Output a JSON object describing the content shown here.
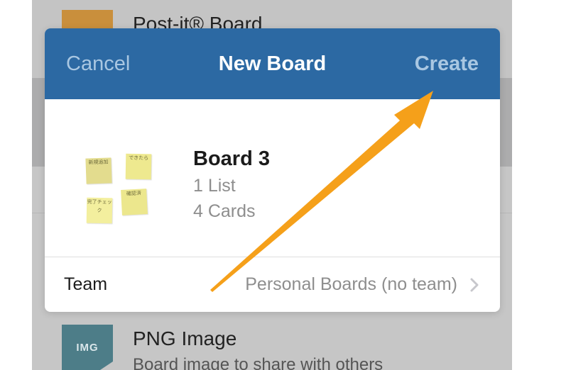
{
  "background": {
    "top_item": {
      "title": "Post-it® Board"
    },
    "bottom_item": {
      "thumb_label": "IMG",
      "title": "PNG Image",
      "subtitle": "Board image to share with others"
    }
  },
  "modal": {
    "nav": {
      "cancel_label": "Cancel",
      "title": "New Board",
      "create_label": "Create"
    },
    "board": {
      "name": "Board 3",
      "lists": "1 List",
      "cards": "4 Cards",
      "notes": [
        {
          "text": "新規追加",
          "color": "#e3dc8e"
        },
        {
          "text": "できたら",
          "color": "#eee98f"
        },
        {
          "text": "完了チェック",
          "color": "#f3ef9e"
        },
        {
          "text": "確認済",
          "color": "#ece78d"
        }
      ]
    },
    "team": {
      "label": "Team",
      "value": "Personal Boards (no team)"
    }
  },
  "colors": {
    "nav_bar": "#2c69a3",
    "nav_button": "#a9c7e2",
    "annotation_arrow": "#f5a01a"
  },
  "icons": {
    "team_disclosure": "chevron-right-icon",
    "annotation": "arrow-icon"
  }
}
